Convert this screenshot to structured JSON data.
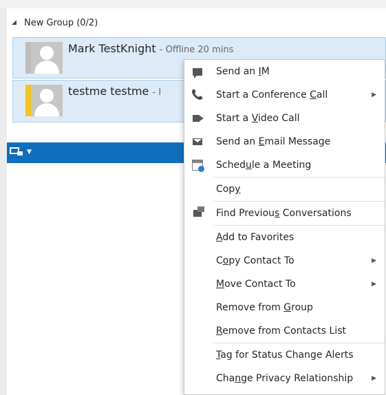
{
  "group": {
    "label": "New Group (0/2)"
  },
  "contacts": [
    {
      "name": "Mark TestKnight",
      "status": "- Offline 20 mins"
    },
    {
      "name": "testme testme",
      "status": "- I"
    }
  ],
  "menu": {
    "items": [
      {
        "pre": "Send an ",
        "u": "I",
        "post": "M",
        "icon": "im-bubble-icon"
      },
      {
        "pre": "Start a Conference ",
        "u": "C",
        "post": "all",
        "icon": "phone-icon",
        "submenu": true
      },
      {
        "pre": "Start a ",
        "u": "V",
        "post": "ideo Call",
        "icon": "video-camera-icon"
      },
      {
        "pre": "Send an ",
        "u": "E",
        "post": "mail Message",
        "icon": "mail-icon"
      },
      {
        "pre": "Sched",
        "u": "u",
        "post": "le a Meeting",
        "icon": "calendar-icon"
      },
      {
        "pre": "Cop",
        "u": "y",
        "post": ""
      },
      {
        "pre": "Find Previou",
        "u": "s",
        "post": " Conversations",
        "icon": "conversation-history-icon"
      },
      {
        "pre": "",
        "u": "A",
        "post": "dd to Favorites"
      },
      {
        "pre": "C",
        "u": "o",
        "post": "py Contact To",
        "submenu": true
      },
      {
        "pre": "",
        "u": "M",
        "post": "ove Contact To",
        "submenu": true
      },
      {
        "pre": "Remove from ",
        "u": "G",
        "post": "roup"
      },
      {
        "pre": "",
        "u": "R",
        "post": "emove from Contacts List"
      },
      {
        "pre": "",
        "u": "T",
        "post": "ag for Status Change Alerts"
      },
      {
        "pre": "Cha",
        "u": "n",
        "post": "ge Privacy Relationship",
        "submenu": true
      }
    ],
    "submenu_arrow": "▶"
  },
  "colors": {
    "toolbar": "#106ebe",
    "selected_row": "#dcebf7",
    "away_presence": "#f5c518"
  }
}
